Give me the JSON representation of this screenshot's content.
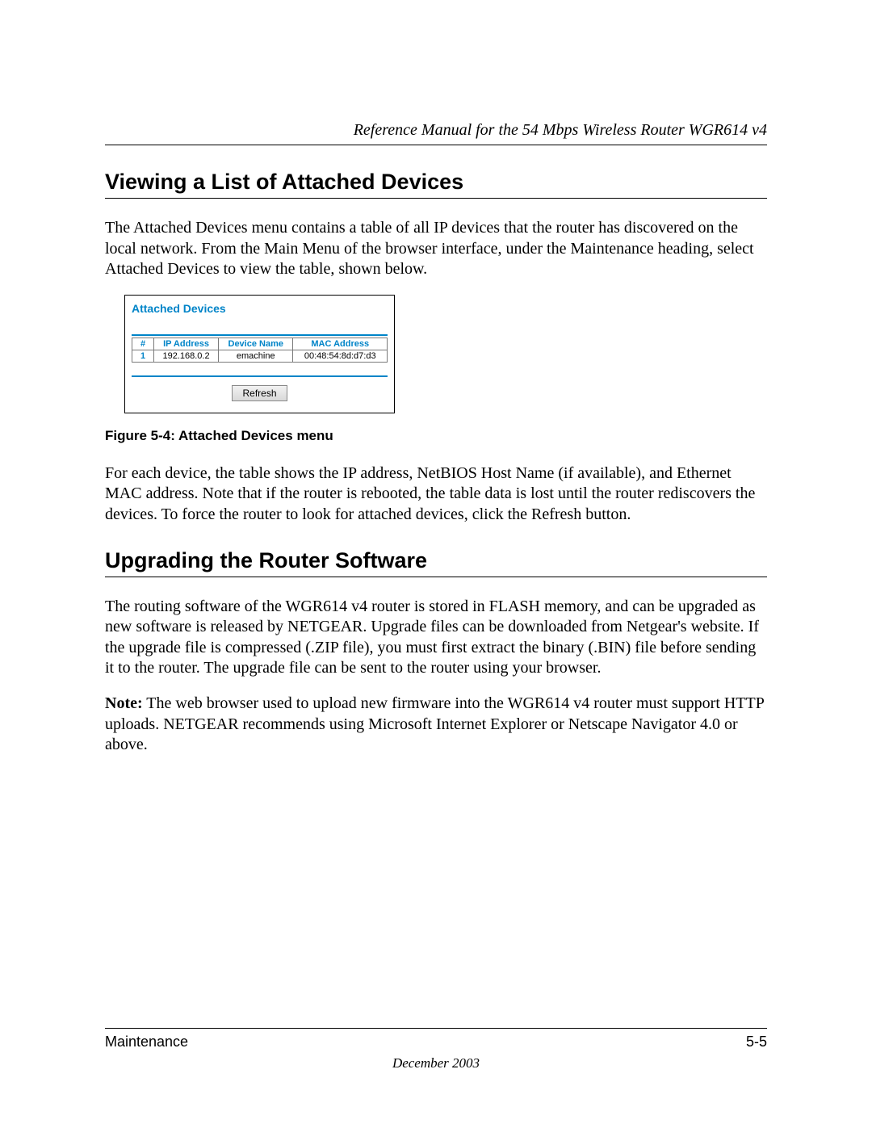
{
  "header": {
    "running_title": "Reference Manual for the 54 Mbps Wireless Router WGR614 v4"
  },
  "section1": {
    "heading": "Viewing a List of Attached Devices",
    "para1": "The Attached Devices menu contains a table of all IP devices that the router has discovered on the local network. From the Main Menu of the browser interface, under the Maintenance heading, select Attached Devices to view the table, shown below."
  },
  "screenshot": {
    "title": "Attached Devices",
    "columns": {
      "num": "#",
      "ip": "IP Address",
      "name": "Device Name",
      "mac": "MAC Address"
    },
    "rows": [
      {
        "num": "1",
        "ip": "192.168.0.2",
        "name": "emachine",
        "mac": "00:48:54:8d:d7:d3"
      }
    ],
    "refresh_label": "Refresh"
  },
  "figure_caption": "Figure 5-4:  Attached Devices menu",
  "section1b": {
    "para2": "For each device, the table shows the IP address, NetBIOS Host Name (if available), and Ethernet MAC address. Note that if the router is rebooted, the table data is lost until the router rediscovers the devices. To force the router to look for attached devices, click the Refresh button."
  },
  "section2": {
    "heading": "Upgrading the Router Software",
    "para1": "The routing software of the WGR614 v4 router is stored in FLASH memory, and can be upgraded as new software is released by NETGEAR. Upgrade files can be downloaded from Netgear's website. If the upgrade file is compressed (.ZIP file), you must first extract the binary (.BIN) file before sending it to the router. The upgrade file can be sent to the router using your browser.",
    "note_label": "Note:",
    "note_body": " The web browser used to upload new firmware into the WGR614 v4 router must support HTTP uploads. NETGEAR recommends using Microsoft Internet Explorer or Netscape Navigator 4.0 or above."
  },
  "footer": {
    "section": "Maintenance",
    "page": "5-5",
    "date": "December 2003"
  }
}
